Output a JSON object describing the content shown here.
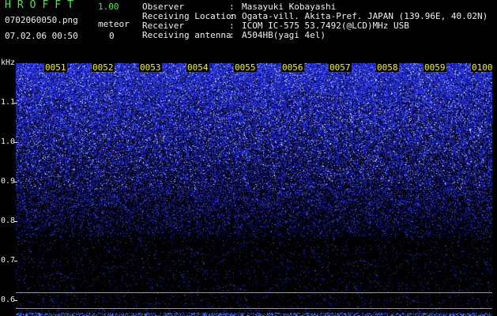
{
  "header": {
    "app_name": "HROFFT",
    "version": "1.00",
    "filename": "0702060050.png",
    "meteor_label": "meteor",
    "datetime": "07.02.06 00:50",
    "meteor_count": "0"
  },
  "info": [
    {
      "label": "Observer",
      "value": "Masayuki Kobayashi"
    },
    {
      "label": "Receiving Location",
      "value": "Ogata-vill. Akita-Pref. JAPAN (139.96E, 40.02N)"
    },
    {
      "label": "Receiver",
      "value": "ICOM IC-575 53.7492(@LCD)MHz USB"
    },
    {
      "label": "Receiving antenna",
      "value": "A504HB(yagi 4el)"
    }
  ],
  "info_separator": ":",
  "axis": {
    "unit": "kHz",
    "y_labels": [
      "1.1",
      "1.0",
      "0.9",
      "0.8",
      "0.7",
      "0.6"
    ],
    "y_range": [
      0.57,
      1.2
    ]
  },
  "time_labels": [
    "0051",
    "0052",
    "0053",
    "0054",
    "0055",
    "0056",
    "0057",
    "0058",
    "0059",
    "0100"
  ],
  "colors": {
    "background": "#000000",
    "signal": "#2a36ff",
    "signal_bright": "#d8e4ff",
    "text_green": "#3cf23c",
    "text_yellow": "#f5f500",
    "text_white": "#f0f0f0"
  }
}
